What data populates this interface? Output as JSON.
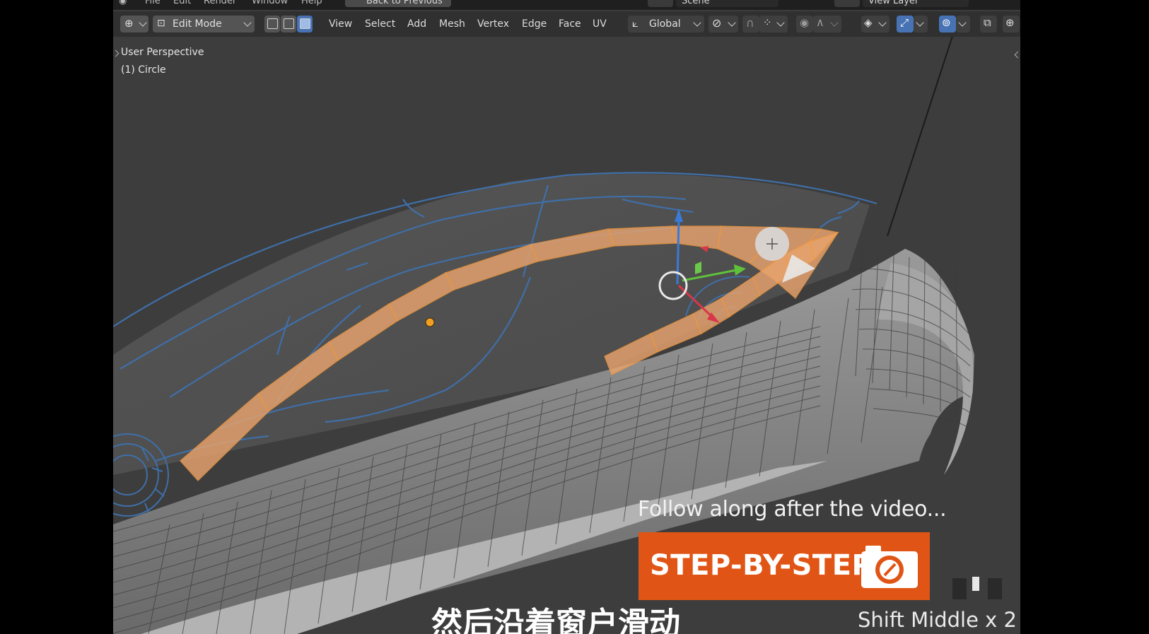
{
  "app": {
    "name": "Blender"
  },
  "top_bar": {
    "menus": [
      "File",
      "Edit",
      "Render",
      "Window",
      "Help"
    ],
    "back_button": "Back to Previous",
    "scene": "Scene",
    "view_layer": "View Layer"
  },
  "toolbar": {
    "mode": "Edit Mode",
    "menus": [
      "View",
      "Select",
      "Add",
      "Mesh",
      "Vertex",
      "Edge",
      "Face",
      "UV"
    ],
    "transform_orientation": "Global"
  },
  "viewport": {
    "view_name": "User Perspective",
    "object_name": "(1) Circle"
  },
  "overlay": {
    "follow_text": "Follow along after the video...",
    "badge_text": "STEP-BY-STEP",
    "subtitle_cn": "然后沿着窗户滑动",
    "key_hint": "Shift Middle x 2"
  },
  "colors": {
    "selection": "#e8a36e",
    "selection_edge": "#f59a3c",
    "wire_blue": "#3f6fa8",
    "badge_orange": "#e05515",
    "viewport_bg": "#3d3d3d",
    "header_bg": "#303030"
  }
}
